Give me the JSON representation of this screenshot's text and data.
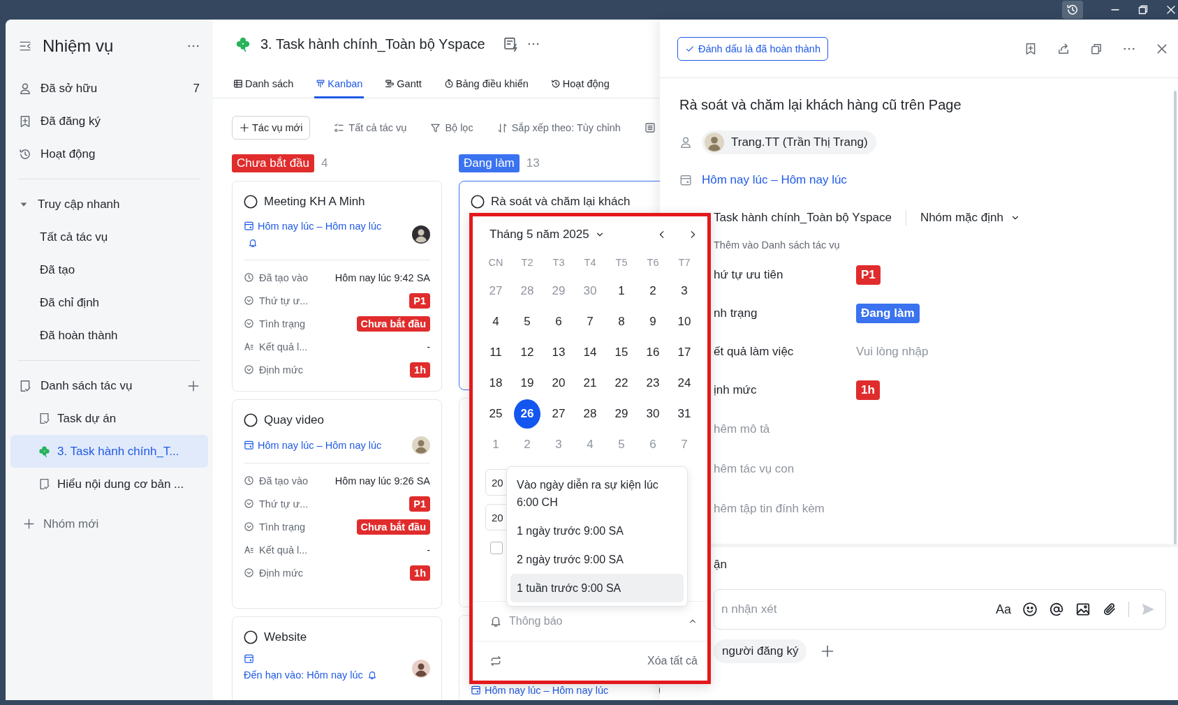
{
  "sidebar": {
    "title": "Nhiệm vụ",
    "items": [
      {
        "label": "Đã sở hữu",
        "count": "7",
        "selected": false
      },
      {
        "label": "Đã đăng ký",
        "selected": false
      },
      {
        "label": "Hoạt động",
        "selected": false
      }
    ],
    "quick_access": {
      "label": "Truy cập nhanh",
      "expanded": true,
      "children": [
        {
          "label": "Tất cả tác vụ",
          "selected": false
        },
        {
          "label": "Đã tạo",
          "selected": false
        },
        {
          "label": "Đã chỉ định",
          "selected": false
        },
        {
          "label": "Đã hoàn thành",
          "selected": false
        }
      ]
    },
    "task_lists": {
      "label": "Danh sách tác vụ",
      "children": [
        {
          "label": "Task dự án",
          "selected": false
        },
        {
          "label": "3. Task hành chính_T...",
          "selected": true
        },
        {
          "label": "Hiểu nội dung cơ bản ...",
          "selected": false
        }
      ]
    },
    "new_group": "Nhóm mới"
  },
  "header": {
    "title": "3. Task hành chính_Toàn bộ Yspace"
  },
  "tabs": [
    {
      "label": "Danh sách",
      "selected": false
    },
    {
      "label": "Kanban",
      "selected": true
    },
    {
      "label": "Gantt",
      "selected": false
    },
    {
      "label": "Bảng điều khiển",
      "selected": false
    },
    {
      "label": "Hoạt động",
      "selected": false
    }
  ],
  "toolbar": {
    "new_task": "Tác vụ mới",
    "items": [
      "Tất cả tác vụ",
      "Bộ lọc",
      "Sắp xếp theo: Tùy chỉnh"
    ]
  },
  "columns": [
    {
      "status": "Chưa bắt đầu",
      "count": "4",
      "color": "#e02c2c",
      "cards": [
        {
          "title": "Meeting KH A Minh",
          "selected": false,
          "date": {
            "text": "Hôm nay lúc – Hôm nay lúc",
            "kind": "range",
            "bell": true
          },
          "fields": [
            {
              "label": "Đã tạo vào",
              "value": "Hôm nay lúc 9:42 SA",
              "kind": "text"
            },
            {
              "label": "Thứ tự ư...",
              "value": "P1",
              "kind": "badge",
              "color": "#e02c2c"
            },
            {
              "label": "Tình trạng",
              "value": "Chưa bắt đầu",
              "kind": "badge",
              "color": "#e02c2c"
            },
            {
              "label": "Kết quả l...",
              "value": "-",
              "kind": "text"
            },
            {
              "label": "Định mức",
              "value": "1h",
              "kind": "badge",
              "color": "#e02c2c"
            }
          ]
        },
        {
          "title": "Quay video",
          "selected": false,
          "date": {
            "text": "Hôm nay lúc – Hôm nay lúc",
            "kind": "range",
            "bell": false
          },
          "fields": [
            {
              "label": "Đã tạo vào",
              "value": "Hôm nay lúc 9:26 SA",
              "kind": "text"
            },
            {
              "label": "Thứ tự ư...",
              "value": "P1",
              "kind": "badge",
              "color": "#e02c2c"
            },
            {
              "label": "Tình trạng",
              "value": "Chưa bắt đầu",
              "kind": "badge",
              "color": "#e02c2c"
            },
            {
              "label": "Kết quả l...",
              "value": "-",
              "kind": "text"
            },
            {
              "label": "Định mức",
              "value": "1h",
              "kind": "badge",
              "color": "#e02c2c"
            }
          ]
        },
        {
          "title": "Website",
          "selected": false,
          "date": {
            "text": "Đến hạn vào: Hôm nay lúc",
            "kind": "due",
            "bell": true
          }
        }
      ]
    },
    {
      "status": "Đang làm",
      "count": "13",
      "color": "#3a72f0",
      "cards": [
        {
          "title": "Rà soát và chăm lại khách",
          "selected": true
        },
        {
          "selected": false
        },
        {
          "selected": false,
          "date": {
            "text": "Hôm nay lúc – Hôm nay lúc",
            "kind": "range",
            "bell": false
          }
        }
      ]
    }
  ],
  "date_picker": {
    "month": "Tháng 5 năm 2025",
    "weekdays": [
      "CN",
      "T2",
      "T3",
      "T4",
      "T5",
      "T6",
      "T7"
    ],
    "days": [
      {
        "label": "27",
        "outside": true,
        "selected": false
      },
      {
        "label": "28",
        "outside": true,
        "selected": false
      },
      {
        "label": "29",
        "outside": true,
        "selected": false
      },
      {
        "label": "30",
        "outside": true,
        "selected": false
      },
      {
        "label": "1",
        "outside": false,
        "selected": false
      },
      {
        "label": "2",
        "outside": false,
        "selected": false
      },
      {
        "label": "3",
        "outside": false,
        "selected": false
      },
      {
        "label": "4",
        "outside": false,
        "selected": false
      },
      {
        "label": "5",
        "outside": false,
        "selected": false
      },
      {
        "label": "6",
        "outside": false,
        "selected": false
      },
      {
        "label": "7",
        "outside": false,
        "selected": false
      },
      {
        "label": "8",
        "outside": false,
        "selected": false
      },
      {
        "label": "9",
        "outside": false,
        "selected": false
      },
      {
        "label": "10",
        "outside": false,
        "selected": false
      },
      {
        "label": "11",
        "outside": false,
        "selected": false
      },
      {
        "label": "12",
        "outside": false,
        "selected": false
      },
      {
        "label": "13",
        "outside": false,
        "selected": false
      },
      {
        "label": "14",
        "outside": false,
        "selected": false
      },
      {
        "label": "15",
        "outside": false,
        "selected": false
      },
      {
        "label": "16",
        "outside": false,
        "selected": false
      },
      {
        "label": "17",
        "outside": false,
        "selected": false
      },
      {
        "label": "18",
        "outside": false,
        "selected": false
      },
      {
        "label": "19",
        "outside": false,
        "selected": false
      },
      {
        "label": "20",
        "outside": false,
        "selected": false
      },
      {
        "label": "21",
        "outside": false,
        "selected": false
      },
      {
        "label": "22",
        "outside": false,
        "selected": false
      },
      {
        "label": "23",
        "outside": false,
        "selected": false
      },
      {
        "label": "24",
        "outside": false,
        "selected": false
      },
      {
        "label": "25",
        "outside": false,
        "selected": false
      },
      {
        "label": "26",
        "outside": false,
        "selected": true
      },
      {
        "label": "27",
        "outside": false,
        "selected": false
      },
      {
        "label": "28",
        "outside": false,
        "selected": false
      },
      {
        "label": "29",
        "outside": false,
        "selected": false
      },
      {
        "label": "30",
        "outside": false,
        "selected": false
      },
      {
        "label": "31",
        "outside": false,
        "selected": false
      },
      {
        "label": "1",
        "outside": true,
        "selected": false
      },
      {
        "label": "2",
        "outside": true,
        "selected": false
      },
      {
        "label": "3",
        "outside": true,
        "selected": false
      },
      {
        "label": "4",
        "outside": true,
        "selected": false
      },
      {
        "label": "5",
        "outside": true,
        "selected": false
      },
      {
        "label": "6",
        "outside": true,
        "selected": false
      },
      {
        "label": "7",
        "outside": true,
        "selected": false
      }
    ],
    "date_inputs": [
      "20",
      "20"
    ],
    "all_day_checked": false,
    "reminder_options": [
      {
        "label": "Vào ngày diễn ra sự kiện lúc 6:00 CH",
        "selected": false
      },
      {
        "label": "1 ngày trước 9:00 SA",
        "selected": false
      },
      {
        "label": "2 ngày trước 9:00 SA",
        "selected": false
      },
      {
        "label": "1 tuần trước 9:00 SA",
        "selected": true
      }
    ],
    "notification": {
      "label": "Thông báo",
      "expanded": true
    },
    "clear_all": "Xóa tất cả"
  },
  "detail": {
    "complete_button": "Đánh dấu là đã hoàn thành",
    "title": "Rà soát và chăm lại khách hàng cũ trên Page",
    "assignee": "Trang.TT (Trần Thị Trang)",
    "date": "Hôm nay lúc – Hôm nay lúc",
    "task_list": "Task hành chính_Toàn bộ Yspace",
    "group": "Nhóm mặc định",
    "add_to_list": "Thêm vào Danh sách tác vụ",
    "fields": [
      {
        "label": "hứ tự ưu tiên",
        "value": "P1",
        "kind": "badge",
        "color": "#e02c2c"
      },
      {
        "label": "nh trạng",
        "value": "Đang làm",
        "kind": "badge",
        "color": "#3a72f0"
      },
      {
        "label": "ết quả làm việc",
        "placeholder": "Vui lòng nhập",
        "kind": "input"
      },
      {
        "label": "ịnh mức",
        "value": "1h",
        "kind": "badge",
        "color": "#e02c2c"
      }
    ],
    "actions": [
      "hêm mô tả",
      "hêm tác vụ con",
      "hêm tập tin đính kèm"
    ],
    "comments_label": "ận",
    "comment_placeholder": "n nhận xét",
    "format_button": "Aa",
    "subscribers": "người đăng ký"
  }
}
